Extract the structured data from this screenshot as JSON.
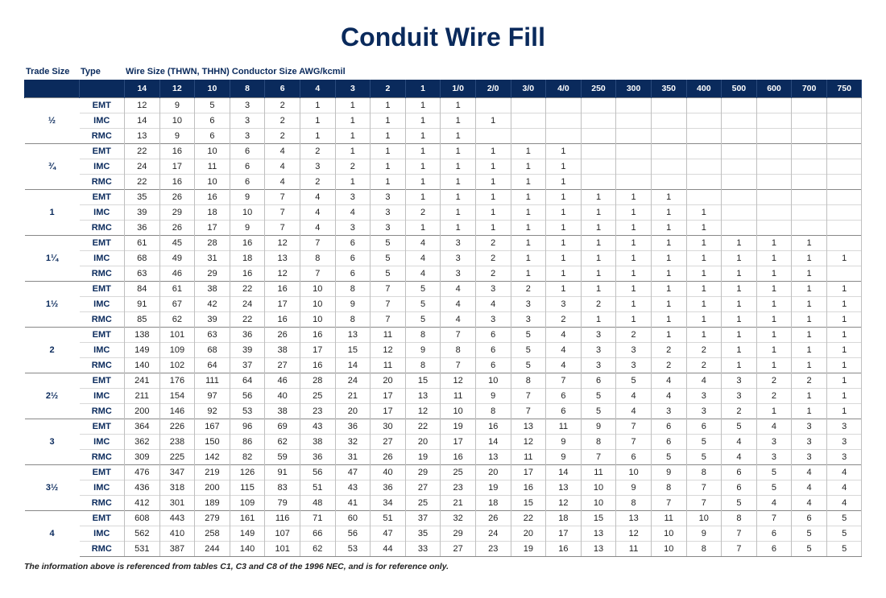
{
  "title": "Conduit Wire Fill",
  "header_labels": {
    "trade_size": "Trade Size",
    "type": "Type",
    "wire_size": "Wire Size (THWN, THHN) Conductor Size AWG/kcmil"
  },
  "footnote": "The information above is referenced from tables C1, C3 and C8 of the 1996 NEC, and is for reference only.",
  "chart_data": {
    "type": "table",
    "columns": [
      "14",
      "12",
      "10",
      "8",
      "6",
      "4",
      "3",
      "2",
      "1",
      "1/0",
      "2/0",
      "3/0",
      "4/0",
      "250",
      "300",
      "350",
      "400",
      "500",
      "600",
      "700",
      "750"
    ],
    "groups": [
      {
        "trade_size": "½",
        "rows": [
          {
            "type": "EMT",
            "values": [
              "12",
              "9",
              "5",
              "3",
              "2",
              "1",
              "1",
              "1",
              "1",
              "1",
              "",
              "",
              "",
              "",
              "",
              "",
              "",
              "",
              "",
              "",
              ""
            ]
          },
          {
            "type": "IMC",
            "values": [
              "14",
              "10",
              "6",
              "3",
              "2",
              "1",
              "1",
              "1",
              "1",
              "1",
              "1",
              "",
              "",
              "",
              "",
              "",
              "",
              "",
              "",
              "",
              ""
            ]
          },
          {
            "type": "RMC",
            "values": [
              "13",
              "9",
              "6",
              "3",
              "2",
              "1",
              "1",
              "1",
              "1",
              "1",
              "",
              "",
              "",
              "",
              "",
              "",
              "",
              "",
              "",
              "",
              ""
            ]
          }
        ]
      },
      {
        "trade_size": "¾",
        "rows": [
          {
            "type": "EMT",
            "values": [
              "22",
              "16",
              "10",
              "6",
              "4",
              "2",
              "1",
              "1",
              "1",
              "1",
              "1",
              "1",
              "1",
              "",
              "",
              "",
              "",
              "",
              "",
              "",
              ""
            ]
          },
          {
            "type": "IMC",
            "values": [
              "24",
              "17",
              "11",
              "6",
              "4",
              "3",
              "2",
              "1",
              "1",
              "1",
              "1",
              "1",
              "1",
              "",
              "",
              "",
              "",
              "",
              "",
              "",
              ""
            ]
          },
          {
            "type": "RMC",
            "values": [
              "22",
              "16",
              "10",
              "6",
              "4",
              "2",
              "1",
              "1",
              "1",
              "1",
              "1",
              "1",
              "1",
              "",
              "",
              "",
              "",
              "",
              "",
              "",
              ""
            ]
          }
        ]
      },
      {
        "trade_size": "1",
        "rows": [
          {
            "type": "EMT",
            "values": [
              "35",
              "26",
              "16",
              "9",
              "7",
              "4",
              "3",
              "3",
              "1",
              "1",
              "1",
              "1",
              "1",
              "1",
              "1",
              "1",
              "",
              "",
              "",
              "",
              ""
            ]
          },
          {
            "type": "IMC",
            "values": [
              "39",
              "29",
              "18",
              "10",
              "7",
              "4",
              "4",
              "3",
              "2",
              "1",
              "1",
              "1",
              "1",
              "1",
              "1",
              "1",
              "1",
              "",
              "",
              "",
              ""
            ]
          },
          {
            "type": "RMC",
            "values": [
              "36",
              "26",
              "17",
              "9",
              "7",
              "4",
              "3",
              "3",
              "1",
              "1",
              "1",
              "1",
              "1",
              "1",
              "1",
              "1",
              "1",
              "",
              "",
              "",
              ""
            ]
          }
        ]
      },
      {
        "trade_size": "1¼",
        "rows": [
          {
            "type": "EMT",
            "values": [
              "61",
              "45",
              "28",
              "16",
              "12",
              "7",
              "6",
              "5",
              "4",
              "3",
              "2",
              "1",
              "1",
              "1",
              "1",
              "1",
              "1",
              "1",
              "1",
              "1",
              ""
            ]
          },
          {
            "type": "IMC",
            "values": [
              "68",
              "49",
              "31",
              "18",
              "13",
              "8",
              "6",
              "5",
              "4",
              "3",
              "2",
              "1",
              "1",
              "1",
              "1",
              "1",
              "1",
              "1",
              "1",
              "1",
              "1"
            ]
          },
          {
            "type": "RMC",
            "values": [
              "63",
              "46",
              "29",
              "16",
              "12",
              "7",
              "6",
              "5",
              "4",
              "3",
              "2",
              "1",
              "1",
              "1",
              "1",
              "1",
              "1",
              "1",
              "1",
              "1",
              ""
            ]
          }
        ]
      },
      {
        "trade_size": "1½",
        "rows": [
          {
            "type": "EMT",
            "values": [
              "84",
              "61",
              "38",
              "22",
              "16",
              "10",
              "8",
              "7",
              "5",
              "4",
              "3",
              "2",
              "1",
              "1",
              "1",
              "1",
              "1",
              "1",
              "1",
              "1",
              "1"
            ]
          },
          {
            "type": "IMC",
            "values": [
              "91",
              "67",
              "42",
              "24",
              "17",
              "10",
              "9",
              "7",
              "5",
              "4",
              "4",
              "3",
              "3",
              "2",
              "1",
              "1",
              "1",
              "1",
              "1",
              "1",
              "1"
            ]
          },
          {
            "type": "RMC",
            "values": [
              "85",
              "62",
              "39",
              "22",
              "16",
              "10",
              "8",
              "7",
              "5",
              "4",
              "3",
              "3",
              "2",
              "1",
              "1",
              "1",
              "1",
              "1",
              "1",
              "1",
              "1"
            ]
          }
        ]
      },
      {
        "trade_size": "2",
        "rows": [
          {
            "type": "EMT",
            "values": [
              "138",
              "101",
              "63",
              "36",
              "26",
              "16",
              "13",
              "11",
              "8",
              "7",
              "6",
              "5",
              "4",
              "3",
              "2",
              "1",
              "1",
              "1",
              "1",
              "1",
              "1"
            ]
          },
          {
            "type": "IMC",
            "values": [
              "149",
              "109",
              "68",
              "39",
              "38",
              "17",
              "15",
              "12",
              "9",
              "8",
              "6",
              "5",
              "4",
              "3",
              "3",
              "2",
              "2",
              "1",
              "1",
              "1",
              "1"
            ]
          },
          {
            "type": "RMC",
            "values": [
              "140",
              "102",
              "64",
              "37",
              "27",
              "16",
              "14",
              "11",
              "8",
              "7",
              "6",
              "5",
              "4",
              "3",
              "3",
              "2",
              "2",
              "1",
              "1",
              "1",
              "1"
            ]
          }
        ]
      },
      {
        "trade_size": "2½",
        "rows": [
          {
            "type": "EMT",
            "values": [
              "241",
              "176",
              "111",
              "64",
              "46",
              "28",
              "24",
              "20",
              "15",
              "12",
              "10",
              "8",
              "7",
              "6",
              "5",
              "4",
              "4",
              "3",
              "2",
              "2",
              "1"
            ]
          },
          {
            "type": "IMC",
            "values": [
              "211",
              "154",
              "97",
              "56",
              "40",
              "25",
              "21",
              "17",
              "13",
              "11",
              "9",
              "7",
              "6",
              "5",
              "4",
              "4",
              "3",
              "3",
              "2",
              "1",
              "1"
            ]
          },
          {
            "type": "RMC",
            "values": [
              "200",
              "146",
              "92",
              "53",
              "38",
              "23",
              "20",
              "17",
              "12",
              "10",
              "8",
              "7",
              "6",
              "5",
              "4",
              "3",
              "3",
              "2",
              "1",
              "1",
              "1"
            ]
          }
        ]
      },
      {
        "trade_size": "3",
        "rows": [
          {
            "type": "EMT",
            "values": [
              "364",
              "226",
              "167",
              "96",
              "69",
              "43",
              "36",
              "30",
              "22",
              "19",
              "16",
              "13",
              "11",
              "9",
              "7",
              "6",
              "6",
              "5",
              "4",
              "3",
              "3"
            ]
          },
          {
            "type": "IMC",
            "values": [
              "362",
              "238",
              "150",
              "86",
              "62",
              "38",
              "32",
              "27",
              "20",
              "17",
              "14",
              "12",
              "9",
              "8",
              "7",
              "6",
              "5",
              "4",
              "3",
              "3",
              "3"
            ]
          },
          {
            "type": "RMC",
            "values": [
              "309",
              "225",
              "142",
              "82",
              "59",
              "36",
              "31",
              "26",
              "19",
              "16",
              "13",
              "11",
              "9",
              "7",
              "6",
              "5",
              "5",
              "4",
              "3",
              "3",
              "3"
            ]
          }
        ]
      },
      {
        "trade_size": "3½",
        "rows": [
          {
            "type": "EMT",
            "values": [
              "476",
              "347",
              "219",
              "126",
              "91",
              "56",
              "47",
              "40",
              "29",
              "25",
              "20",
              "17",
              "14",
              "11",
              "10",
              "9",
              "8",
              "6",
              "5",
              "4",
              "4"
            ]
          },
          {
            "type": "IMC",
            "values": [
              "436",
              "318",
              "200",
              "115",
              "83",
              "51",
              "43",
              "36",
              "27",
              "23",
              "19",
              "16",
              "13",
              "10",
              "9",
              "8",
              "7",
              "6",
              "5",
              "4",
              "4"
            ]
          },
          {
            "type": "RMC",
            "values": [
              "412",
              "301",
              "189",
              "109",
              "79",
              "48",
              "41",
              "34",
              "25",
              "21",
              "18",
              "15",
              "12",
              "10",
              "8",
              "7",
              "7",
              "5",
              "4",
              "4",
              "4"
            ]
          }
        ]
      },
      {
        "trade_size": "4",
        "rows": [
          {
            "type": "EMT",
            "values": [
              "608",
              "443",
              "279",
              "161",
              "116",
              "71",
              "60",
              "51",
              "37",
              "32",
              "26",
              "22",
              "18",
              "15",
              "13",
              "11",
              "10",
              "8",
              "7",
              "6",
              "5"
            ]
          },
          {
            "type": "IMC",
            "values": [
              "562",
              "410",
              "258",
              "149",
              "107",
              "66",
              "56",
              "47",
              "35",
              "29",
              "24",
              "20",
              "17",
              "13",
              "12",
              "10",
              "9",
              "7",
              "6",
              "5",
              "5"
            ]
          },
          {
            "type": "RMC",
            "values": [
              "531",
              "387",
              "244",
              "140",
              "101",
              "62",
              "53",
              "44",
              "33",
              "27",
              "23",
              "19",
              "16",
              "13",
              "11",
              "10",
              "8",
              "7",
              "6",
              "5",
              "5"
            ]
          }
        ]
      }
    ]
  }
}
